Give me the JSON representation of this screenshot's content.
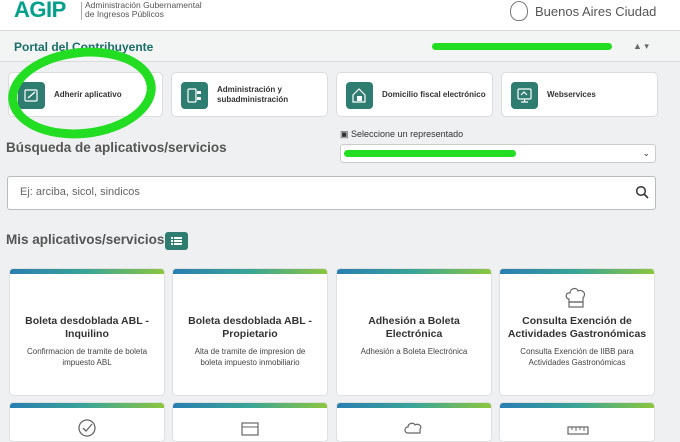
{
  "header": {
    "logo": "AGIP",
    "logo_subtitle_line1": "Administración Gubernamental",
    "logo_subtitle_line2": "de Ingresos Públicos",
    "city_label": "Buenos Aires Ciudad"
  },
  "portal": {
    "title": "Portal del Contribuyente",
    "user_menu": "▲ ▾"
  },
  "quick_actions": [
    {
      "label": "Adherir aplicativo",
      "icon": "adherir-icon"
    },
    {
      "label_line1": "Administración y",
      "label_line2": "subadministración",
      "icon": "admin-icon"
    },
    {
      "label": "Domicilio fiscal electrónico",
      "icon": "domicilio-icon"
    },
    {
      "label": "Webservices",
      "icon": "webservices-icon"
    }
  ],
  "search": {
    "heading": "Búsqueda de aplicativos/servicios",
    "placeholder": "Ej: arciba, sicol, sindicos"
  },
  "representative": {
    "label": "Seleccione un representado"
  },
  "my_apps": {
    "heading": "Mis aplicativos/servicios",
    "cards": [
      {
        "title_line1": "Boleta desdoblada ABL -",
        "title_line2": "Inquilino",
        "desc_line1": "Confirmacion de tramite de boleta",
        "desc_line2": "impuesto ABL"
      },
      {
        "title_line1": "Boleta desdoblada ABL -",
        "title_line2": "Propietario",
        "desc_line1": "Alta de tramite de impresion de",
        "desc_line2": "boleta impuesto inmobiliario"
      },
      {
        "title_line1": "Adhesión a Boleta",
        "title_line2": "Electrónica",
        "desc_line1": "Adhesión a Boleta Electrónica",
        "desc_line2": ""
      },
      {
        "title_line1": "Consulta Exención de",
        "title_line2": "Actividades Gastronómicas",
        "desc_line1": "Consulta Exención de IIBB para",
        "desc_line2": "Actividades Gastronómicas"
      }
    ]
  },
  "colors": {
    "brand": "#00a08a",
    "teal_dark": "#2e7d70",
    "annotation_green": "#22dd22"
  }
}
